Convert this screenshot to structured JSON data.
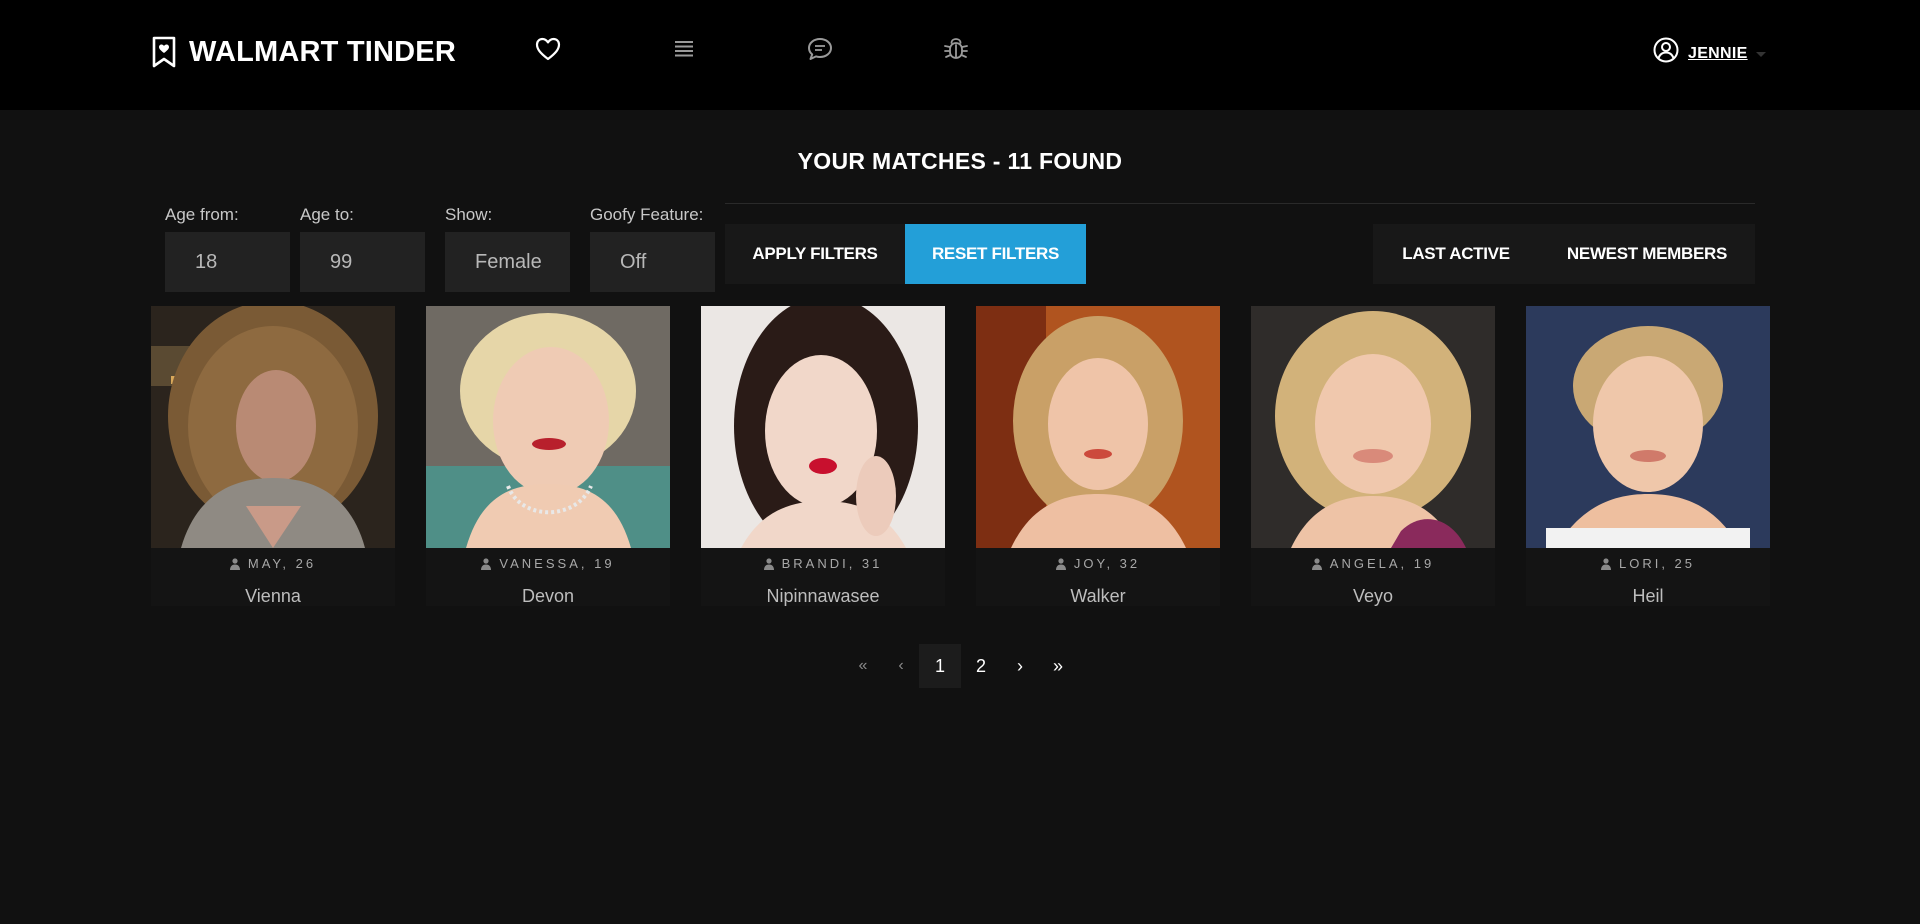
{
  "header": {
    "brand": "WALMART TINDER",
    "user_name": "JENNIE"
  },
  "page": {
    "title": "YOUR MATCHES - 11 FOUND"
  },
  "filters": {
    "age_from": {
      "label": "Age from:",
      "value": "18"
    },
    "age_to": {
      "label": "Age to:",
      "value": "99"
    },
    "show": {
      "label": "Show:",
      "value": "Female"
    },
    "goofy": {
      "label": "Goofy Feature:",
      "value": "Off"
    },
    "apply_label": "APPLY FILTERS",
    "reset_label": "RESET FILTERS"
  },
  "sort": {
    "last_active_label": "LAST ACTIVE",
    "newest_label": "NEWEST MEMBERS"
  },
  "matches": [
    {
      "name": "MAY, 26",
      "city": "Vienna"
    },
    {
      "name": "VANESSA, 19",
      "city": "Devon"
    },
    {
      "name": "BRANDI, 31",
      "city": "Nipinnawasee"
    },
    {
      "name": "JOY, 32",
      "city": "Walker"
    },
    {
      "name": "ANGELA, 19",
      "city": "Veyo"
    },
    {
      "name": "LORI, 25",
      "city": "Heil"
    }
  ],
  "pagination": {
    "first": "«",
    "prev": "‹",
    "pages": [
      "1",
      "2"
    ],
    "current": "1",
    "next": "›",
    "last": "»"
  },
  "colors": {
    "accent": "#239fd8",
    "background": "#111111",
    "topbar": "#000000"
  }
}
